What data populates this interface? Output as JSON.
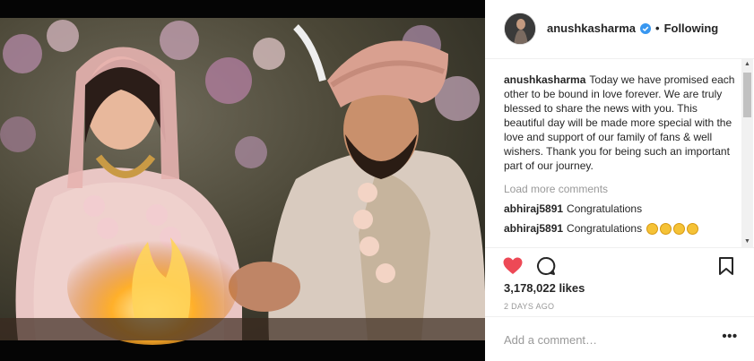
{
  "post": {
    "photo_description_icon": "wedding-photo",
    "username": "anushkasharma",
    "verified": true,
    "separator": "•",
    "follow_status": "Following",
    "caption_user": "anushkasharma",
    "caption_text": "Today we have promised each other to be bound in love forever. We are truly blessed to share the news with you. This beautiful day will be made more special with the love and support of our family of fans & well wishers. Thank you for being such an important part of our journey.",
    "load_more": "Load more comments",
    "comments": [
      {
        "user": "abhiraj5891",
        "text": "Congratulations"
      },
      {
        "user": "abhiraj5891",
        "text": "Congratulations",
        "emoji_count": 4
      }
    ],
    "likes": "3,178,022 likes",
    "posted_time": "2 DAYS AGO",
    "add_comment_placeholder": "Add a comment…",
    "more_options": "•••"
  },
  "colors": {
    "like_red": "#ed4956",
    "verified_blue": "#3897f0",
    "muted_text": "#999999",
    "text": "#262626"
  },
  "icons": [
    "heart-icon",
    "comment-icon",
    "bookmark-icon",
    "verified-badge-icon",
    "more-options-icon"
  ]
}
